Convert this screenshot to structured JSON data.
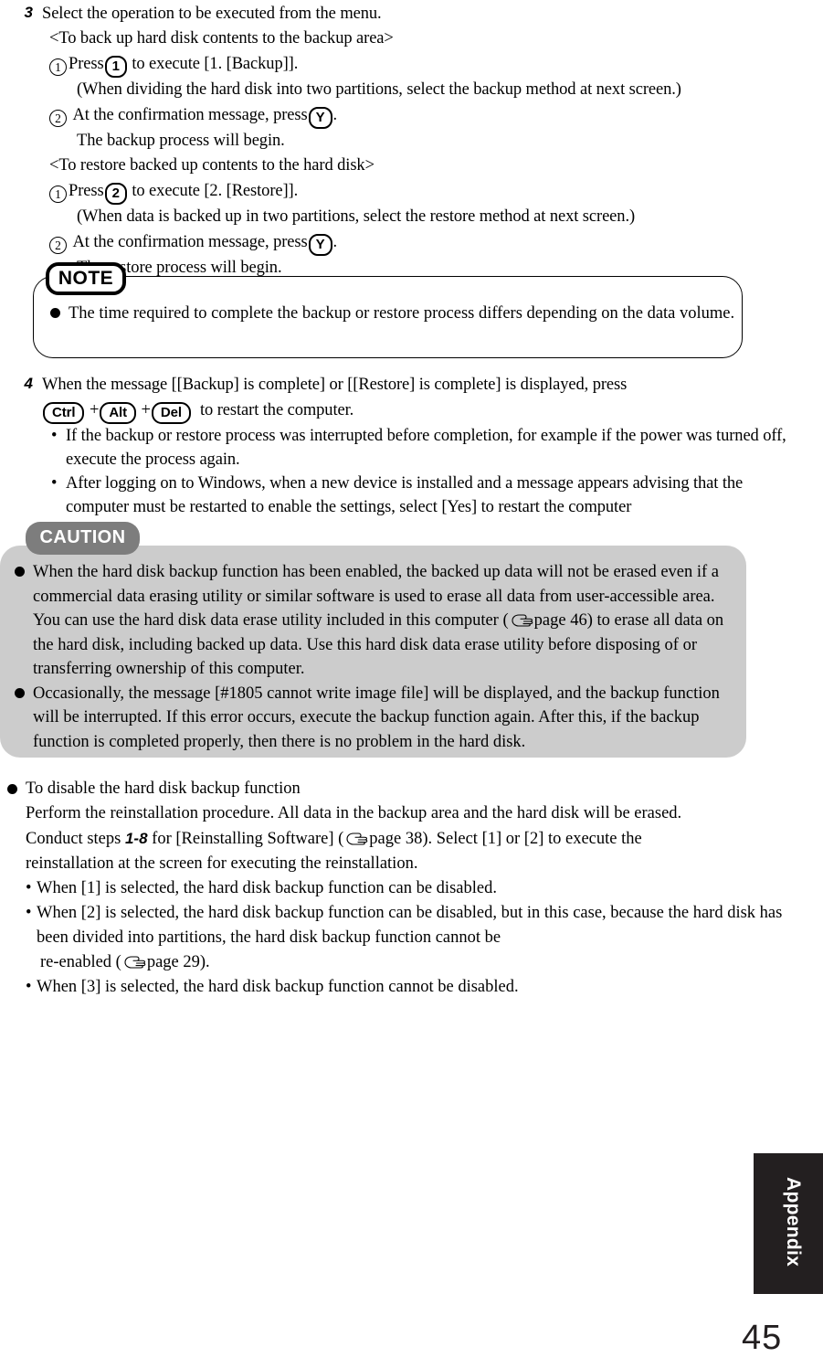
{
  "document": {
    "page_number": "45",
    "side_tab_label": "Appendix"
  },
  "steps": [
    {
      "number": "3",
      "heading": "Select the operation to be executed from the menu.",
      "sections": [
        {
          "title": "<To back up hard disk contents to the backup area>",
          "items": [
            {
              "marker": "1",
              "pre": "Press",
              "key": "1",
              "post": "to execute [1. [Backup]].",
              "sub": "(When dividing the hard disk into two partitions, select the backup method at next screen.)"
            },
            {
              "marker": "2",
              "pre": "At the confirmation message, press",
              "key": "Y",
              "post": ".",
              "sub": "The backup process will begin."
            }
          ]
        },
        {
          "title": "<To restore backed up contents to the hard disk>",
          "items": [
            {
              "marker": "1",
              "pre": "Press",
              "key": "2",
              "post": "to execute [2. [Restore]].",
              "sub": "(When data is backed up in two partitions, select the restore method at next screen.)"
            },
            {
              "marker": "2",
              "pre": "At the confirmation message, press",
              "key": "Y",
              "post": ".",
              "sub": "The restore process will begin."
            }
          ]
        }
      ]
    },
    {
      "number": "4",
      "line1": "When the message [[Backup] is complete] or [[Restore] is complete] is displayed, press",
      "keys": [
        "Ctrl",
        "Alt",
        "Del"
      ],
      "key_separator": "+",
      "line2_tail": "to restart the computer.",
      "bullets": [
        "If the backup or restore process was interrupted before completion, for example if the power was turned off, execute the process again.",
        "After logging on to Windows, when a new device is installed and a message appears advising that the computer must be restarted to enable the settings, select [Yes] to restart the computer"
      ]
    }
  ],
  "note": {
    "badge": "NOTE",
    "items": [
      "The time required to complete the backup or restore process differs depending on the data volume."
    ]
  },
  "caution": {
    "badge": "CAUTION",
    "items": [
      {
        "part1": "When the hard disk backup function has been enabled, the backed up data will not be erased even if a commercial data erasing utility or similar software is used to erase all data from user-accessible area. You can use the hard disk data erase utility included in this computer (",
        "icon": "pointing-hand-icon",
        "part2": "page 46) to erase all data on the hard disk, including backed up data. Use this hard disk data erase utility before disposing of or transferring ownership of this computer."
      },
      {
        "part1": "Occasionally, the message [#1805 cannot write image file] will be displayed, and the backup function will be interrupted.  If this error occurs, execute the backup function again.  After this, if the backup function is completed properly, then there is no problem in the hard disk.",
        "icon": "",
        "part2": ""
      }
    ]
  },
  "disable_section": {
    "heading": "To disable the hard disk backup function",
    "line1": "Perform the reinstallation procedure. All data in the backup area and the hard disk will be erased.",
    "line2_a": "Conduct steps",
    "line2_steps": "1-8",
    "line2_b": "for [Reinstalling Software]  (",
    "line2_page": "page 38). Select [1] or [2] to execute the",
    "line3": "reinstallation at the screen for executing the reinstallation.",
    "bullets": [
      {
        "text": "When [1] is selected, the hard disk backup function can be disabled.",
        "ref_prefix": "",
        "ref_page": ""
      },
      {
        "text": "When [2] is selected, the hard disk backup function can be disabled, but in this case, because the hard disk has been divided into partitions, the hard disk backup function cannot be",
        "ref_prefix": "re-enabled  (",
        "ref_page": "page 29)."
      },
      {
        "text": "When [3] is selected, the hard disk backup function cannot be disabled.",
        "ref_prefix": "",
        "ref_page": ""
      }
    ]
  },
  "icons": {
    "pointing_hand": "pointing-hand-icon",
    "bullet_filled_circle": "filled-circle-bullet-icon",
    "bullet_small_dot": "small-dot-bullet-icon"
  }
}
